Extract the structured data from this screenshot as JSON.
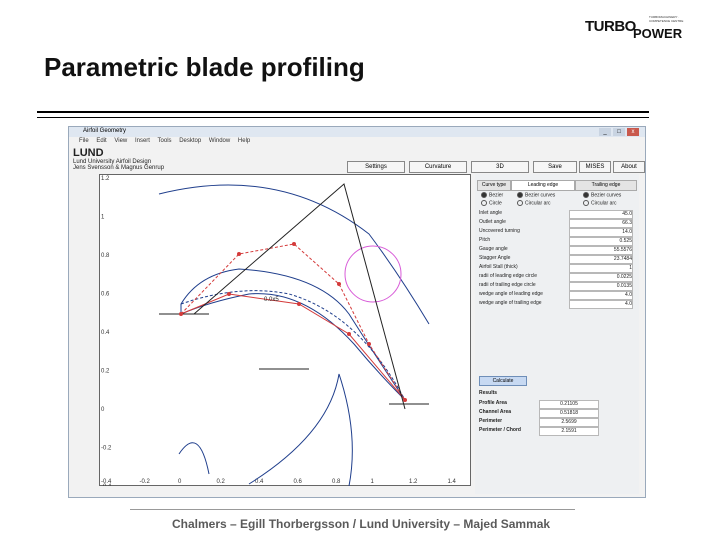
{
  "slide": {
    "title": "Parametric blade profiling",
    "footer": "Chalmers – Egill Thorbergsson / Lund University – Majed Sammak"
  },
  "logo": {
    "line1": "TURBO",
    "line2": "POWER",
    "tagline": "TURBOMACHINERY · COMPETENCE CENTRE"
  },
  "window": {
    "title": "Airfoil Geometry",
    "menu": [
      "File",
      "Edit",
      "View",
      "Insert",
      "Tools",
      "Desktop",
      "Window",
      "Help"
    ],
    "controls": [
      "_",
      "□",
      "x"
    ],
    "header_big": "LUND",
    "header_line1": "Lund University Airfoil Design",
    "header_line2": "Jens Svensson & Magnus Genrup"
  },
  "toolbar": [
    "Settings",
    "Curvature",
    "3D",
    "Save",
    "MISES",
    "About"
  ],
  "plot": {
    "y_ticks": [
      "1.2",
      "1",
      "0.8",
      "0.6",
      "0.4",
      "0.2",
      "0",
      "-0.2",
      "-0.4"
    ],
    "x_ticks": [
      "-0.4",
      "-0.2",
      "0",
      "0.2",
      "0.4",
      "0.6",
      "0.8",
      "1",
      "1.2",
      "1.4"
    ],
    "annotation": "0.0x5",
    "colors": {
      "profile": "#1f3e8c",
      "control": "#d43a3a",
      "circle": "#d85cd8",
      "chord": "#222222"
    }
  },
  "panel": {
    "tabs": [
      "Curve type",
      "Leading edge",
      "Trailing edge"
    ],
    "curve_options": [
      "Bezier",
      "Circle"
    ],
    "le_options": [
      "Bezier curves",
      "Circular arc"
    ],
    "te_options": [
      "Bezier curves",
      "Circular arc"
    ],
    "params": [
      {
        "label": "Inlet angle",
        "value": "45.0"
      },
      {
        "label": "Outlet angle",
        "value": "66.3"
      },
      {
        "label": "Uncovered turning",
        "value": "14.0"
      },
      {
        "label": "Pitch",
        "value": "0.525"
      },
      {
        "label": "Gauge angle",
        "value": "55.5576"
      },
      {
        "label": "Stagger Angle",
        "value": "23.7484"
      },
      {
        "label": "Airfoil Stall (thick)",
        "value": "1"
      },
      {
        "label": "radii of leading edge circle",
        "value": "0.0225"
      },
      {
        "label": "radii of trailing edge circle",
        "value": "0.0135"
      },
      {
        "label": "wedge angle of leading edge",
        "value": "4.0"
      },
      {
        "label": "wedge angle of trailing edge",
        "value": "4.0"
      }
    ],
    "calculate_label": "Calculate",
    "results_title": "Results",
    "results": [
      {
        "label": "Profile Area",
        "value": "0.21105"
      },
      {
        "label": "Channel Area",
        "value": "0.51818"
      },
      {
        "label": "Perimeter",
        "value": "2.5699"
      },
      {
        "label": "Perimeter / Chord",
        "value": "2.1591"
      }
    ]
  }
}
